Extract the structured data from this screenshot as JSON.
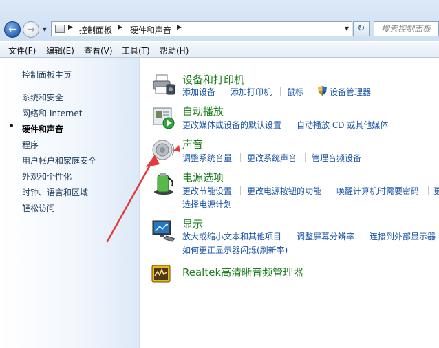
{
  "addressbar": {
    "crumbs": [
      "控制面板",
      "硬件和声音"
    ],
    "search_placeholder": "搜索控制面板"
  },
  "menu": [
    "文件(F)",
    "编辑(E)",
    "查看(V)",
    "工具(T)",
    "帮助(H)"
  ],
  "sidebar": {
    "items": [
      {
        "label": "控制面板主页",
        "active": false
      },
      {
        "label": "系统和安全",
        "active": false
      },
      {
        "label": "网络和 Internet",
        "active": false
      },
      {
        "label": "硬件和声音",
        "active": true
      },
      {
        "label": "程序",
        "active": false
      },
      {
        "label": "用户帐户和家庭安全",
        "active": false
      },
      {
        "label": "外观和个性化",
        "active": false
      },
      {
        "label": "时钟、语言和区域",
        "active": false
      },
      {
        "label": "轻松访问",
        "active": false
      }
    ]
  },
  "groups": [
    {
      "title": "设备和打印机",
      "icon": "printer-icon",
      "links": [
        "添加设备",
        "添加打印机",
        "鼠标",
        "设备管理器"
      ]
    },
    {
      "title": "自动播放",
      "icon": "autoplay-icon",
      "links": [
        "更改媒体或设备的默认设置",
        "自动播放 CD 或其他媒体"
      ]
    },
    {
      "title": "声音",
      "icon": "speaker-icon",
      "links": [
        "调整系统音量",
        "更改系统声音",
        "管理音频设备"
      ]
    },
    {
      "title": "电源选项",
      "icon": "battery-icon",
      "links": [
        "更改节能设置",
        "更改电源按钮的功能",
        "唤醒计算机时需要密码",
        "更"
      ],
      "links2": [
        "选择电源计划"
      ]
    },
    {
      "title": "显示",
      "icon": "monitor-icon",
      "links": [
        "放大或缩小文本和其他项目",
        "调整屏幕分辨率",
        "连接到外部显示器"
      ],
      "links2": [
        "如何更正显示器闪烁(刷新率)"
      ]
    },
    {
      "title": "Realtek高清晰音频管理器",
      "icon": "realtek-icon",
      "links": []
    }
  ],
  "colors": {
    "group_title": "#1c7e1c",
    "link": "#1c55a8",
    "annotation_arrow": "#e43a3a"
  }
}
